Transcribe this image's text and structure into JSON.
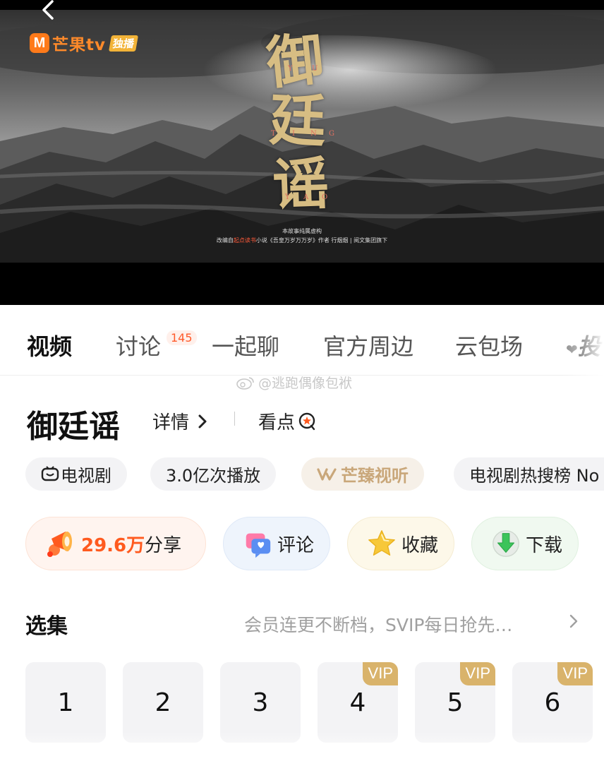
{
  "poster": {
    "logo_mark": "M",
    "logo_brand": "芒果tv",
    "logo_badge": "独播",
    "calligraphy": [
      "御",
      "廷",
      "谣"
    ],
    "pinyin": [
      "Y",
      "U",
      "T",
      "I",
      "N",
      "G",
      "Y",
      "A",
      "O"
    ],
    "disclaimer_line1": "本故事纯属虚构",
    "disclaimer_line2_a": "改编自",
    "disclaimer_line2_highlight": "起点读书",
    "disclaimer_line2_b": "小说《吾皇万岁万万岁》作者 行烟烟 | 阅文集团旗下"
  },
  "tabs": [
    {
      "label": "视频",
      "active": true
    },
    {
      "label": "讨论",
      "badge": "145"
    },
    {
      "label": "一起聊"
    },
    {
      "label": "官方周边"
    },
    {
      "label": "云包场"
    },
    {
      "label": "投"
    }
  ],
  "watermark": "@逃跑偶像包袱",
  "title": "御廷谣",
  "detail_label": "详情",
  "highlights_label": "看点",
  "tags": [
    "电视剧",
    "3.0亿次播放",
    "芒臻视听",
    "电视剧热搜榜 No"
  ],
  "actions": {
    "share_count": "29.6万",
    "share_label": "分享",
    "comment_label": "评论",
    "favorite_label": "收藏",
    "download_label": "下载"
  },
  "episodes": {
    "title": "选集",
    "hint": "会员连更不断档，SVIP每日抢先…",
    "items": [
      {
        "number": "1",
        "vip": false
      },
      {
        "number": "2",
        "vip": false
      },
      {
        "number": "3",
        "vip": false
      },
      {
        "number": "4",
        "vip": true,
        "badge": "VIP"
      },
      {
        "number": "5",
        "vip": true,
        "badge": "VIP"
      },
      {
        "number": "6",
        "vip": true,
        "badge": "VIP"
      }
    ]
  },
  "colors": {
    "brand_orange": "#ff7a1a",
    "accent_red": "#ff5a1f",
    "vip_gold": "#d9b36b",
    "calligraphy_gold": "#d7bd83"
  }
}
